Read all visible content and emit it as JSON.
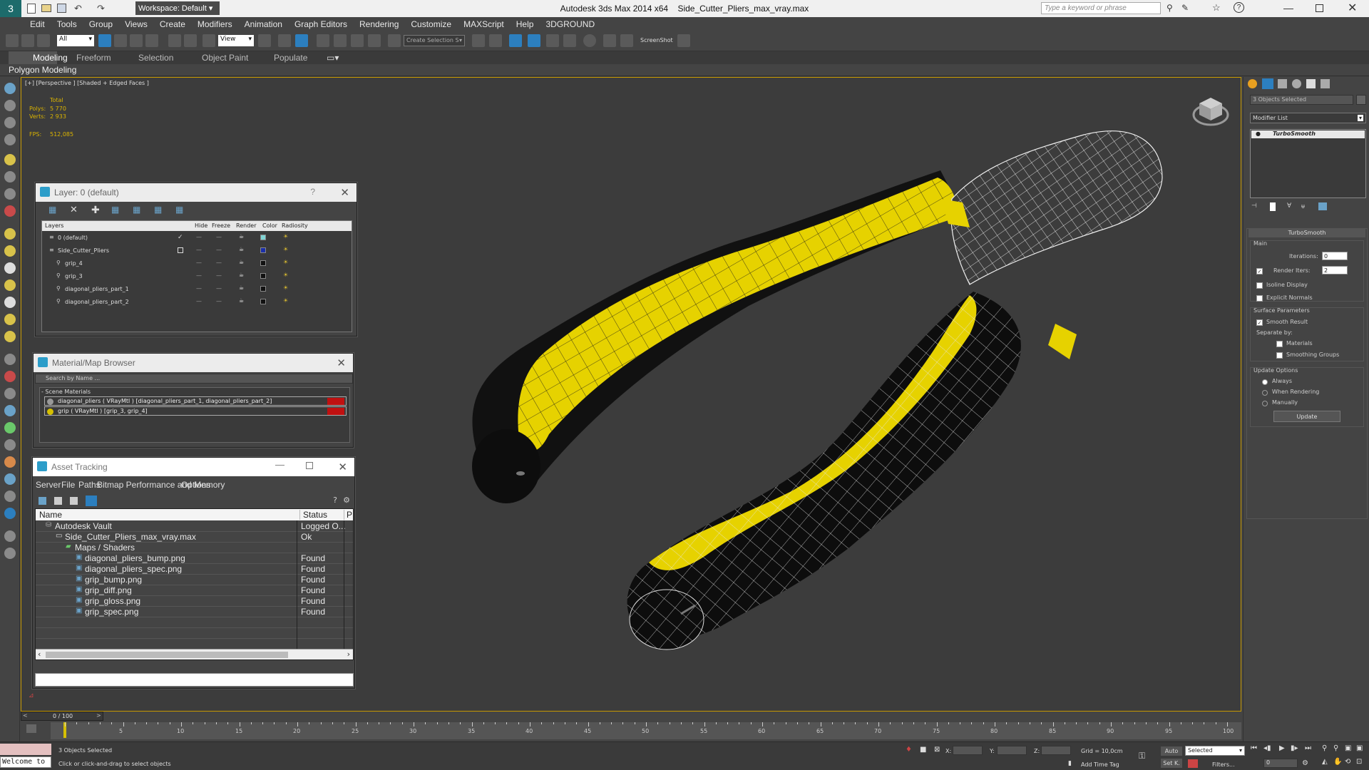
{
  "title": {
    "app": "Autodesk 3ds Max  2014 x64",
    "file": "Side_Cutter_Pliers_max_vray.max",
    "workspace": "Workspace: Default",
    "search_placeholder": "Type a keyword or phrase"
  },
  "menu": [
    "Edit",
    "Tools",
    "Group",
    "Views",
    "Create",
    "Modifiers",
    "Animation",
    "Graph Editors",
    "Rendering",
    "Customize",
    "MAXScript",
    "Help",
    "3DGROUND"
  ],
  "toolbar": {
    "filter": "All",
    "ref_coord": "View",
    "selection_set": "Create Selection S",
    "screenshot": "ScreenShot"
  },
  "ribbon": {
    "tabs": [
      "Modeling",
      "Freeform",
      "Selection",
      "Object Paint",
      "Populate"
    ],
    "active_tab": "Modeling",
    "subtitle": "Polygon Modeling"
  },
  "viewport": {
    "label": "[+] [Perspective ] [Shaded + Edged Faces ]",
    "stats": {
      "total_label": "Total",
      "polys_label": "Polys:",
      "polys_value": "5 770",
      "verts_label": "Verts:",
      "verts_value": "2 933",
      "fps_label": "FPS:",
      "fps_value": "512,085"
    }
  },
  "layer_window": {
    "title": "Layer: 0 (default)",
    "help": "?",
    "columns": [
      "Layers",
      "Hide",
      "Freeze",
      "Render",
      "Color",
      "Radiosity"
    ],
    "rows": [
      {
        "name": "0 (default)",
        "indent": 0,
        "color": "#7fd4d4"
      },
      {
        "name": "Side_Cutter_Pliers",
        "indent": 0,
        "color": "#1a2ea8"
      },
      {
        "name": "grip_4",
        "indent": 1,
        "color": "#111111"
      },
      {
        "name": "grip_3",
        "indent": 1,
        "color": "#111111"
      },
      {
        "name": "diagonal_pliers_part_1",
        "indent": 1,
        "color": "#111111"
      },
      {
        "name": "diagonal_pliers_part_2",
        "indent": 1,
        "color": "#111111"
      }
    ]
  },
  "material_browser": {
    "title": "Material/Map Browser",
    "search_placeholder": "Search by Name ...",
    "group": "- Scene Materials",
    "items": [
      "diagonal_pliers ( VRayMtl ) [diagonal_pliers_part_1, diagonal_pliers_part_2]",
      "grip  ( VRayMtl ) [grip_3, grip_4]"
    ]
  },
  "asset_tracking": {
    "title": "Asset Tracking",
    "menu": [
      "Server",
      "File",
      "Paths",
      "Bitmap Performance and Memory",
      "Options"
    ],
    "columns": [
      "Name",
      "Status",
      "P"
    ],
    "rows": [
      {
        "name": "Autodesk Vault",
        "status": "Logged O...",
        "indent": 1,
        "kind": "vault"
      },
      {
        "name": "Side_Cutter_Pliers_max_vray.max",
        "status": "Ok",
        "indent": 2,
        "kind": "file"
      },
      {
        "name": "Maps / Shaders",
        "status": "",
        "indent": 3,
        "kind": "folder"
      },
      {
        "name": "diagonal_pliers_bump.png",
        "status": "Found",
        "indent": 4,
        "kind": "map"
      },
      {
        "name": "diagonal_pliers_spec.png",
        "status": "Found",
        "indent": 4,
        "kind": "map"
      },
      {
        "name": "grip_bump.png",
        "status": "Found",
        "indent": 4,
        "kind": "map"
      },
      {
        "name": "grip_diff.png",
        "status": "Found",
        "indent": 4,
        "kind": "map"
      },
      {
        "name": "grip_gloss.png",
        "status": "Found",
        "indent": 4,
        "kind": "map"
      },
      {
        "name": "grip_spec.png",
        "status": "Found",
        "indent": 4,
        "kind": "map"
      }
    ]
  },
  "command_panel": {
    "selection": "3 Objects Selected",
    "modifier_list": "Modifier List",
    "stack_item": "TurboSmooth",
    "rollout_title": "TurboSmooth",
    "main_group": "Main",
    "iterations_label": "Iterations:",
    "iterations_value": "0",
    "render_iters_label": "Render Iters:",
    "render_iters_value": "2",
    "isoline": "Isoline Display",
    "explicit_normals": "Explicit Normals",
    "surface_group": "Surface Parameters",
    "smooth_result": "Smooth Result",
    "separate_by": "Separate by:",
    "materials": "Materials",
    "smoothing_groups": "Smoothing Groups",
    "update_group": "Update Options",
    "always": "Always",
    "when_rendering": "When Rendering",
    "manually": "Manually",
    "update_button": "Update"
  },
  "timeline": {
    "frame": "0 / 100",
    "current_frame": 0,
    "max_frame": 100,
    "ticks": [
      "5",
      "10",
      "15",
      "20",
      "25",
      "30",
      "35",
      "40",
      "45",
      "50",
      "55",
      "60",
      "65",
      "70",
      "75",
      "80",
      "85",
      "90",
      "95",
      "100"
    ]
  },
  "status": {
    "welcome": "Welcome to",
    "selected": "3 Objects Selected",
    "prompt": "Click or click-and-drag to select objects",
    "x_label": "X:",
    "y_label": "Y:",
    "z_label": "Z:",
    "grid": "Grid = 10,0cm",
    "auto": "Auto",
    "set_key": "Set K.",
    "selected_dropdown": "Selected",
    "filters": "Filters...",
    "add_time_tag": "Add Time Tag",
    "frame_value": "0"
  }
}
